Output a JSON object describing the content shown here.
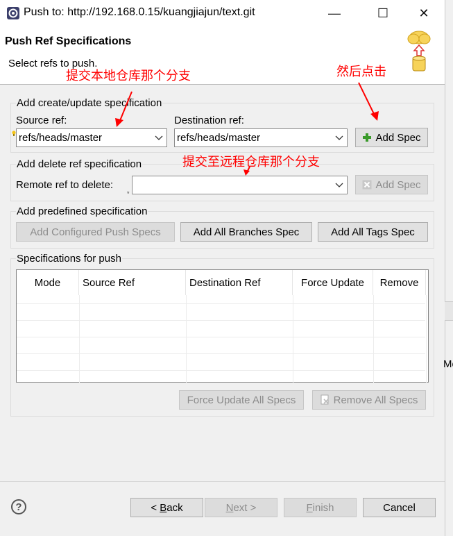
{
  "window": {
    "title": "Push to: http://192.168.0.15/kuangjiajun/text.git",
    "minimize": "—",
    "maximize": "☐",
    "close": "✕"
  },
  "header": {
    "title": "Push Ref Specifications",
    "description": "Select refs to push."
  },
  "create_group": {
    "label": "Add create/update specification",
    "source_label": "Source ref:",
    "source_value": "refs/heads/master",
    "dest_label": "Destination ref:",
    "dest_value": "refs/heads/master",
    "add_spec": "Add Spec"
  },
  "delete_group": {
    "label": "Add delete ref specification",
    "remote_label": "Remote ref to delete:",
    "remote_value": "",
    "add_spec": "Add Spec"
  },
  "predefined_group": {
    "label": "Add predefined specification",
    "configured": "Add Configured Push Specs",
    "all_branches": "Add All Branches Spec",
    "all_tags": "Add All Tags Spec"
  },
  "specs_group": {
    "label": "Specifications for push",
    "columns": [
      "Mode",
      "Source Ref",
      "Destination Ref",
      "Force Update",
      "Remove"
    ],
    "force_all": "Force Update All Specs",
    "remove_all": "Remove All Specs"
  },
  "footer": {
    "help": "?",
    "back_prefix": "< ",
    "back_mn": "B",
    "back_rest": "ack",
    "next_mn": "N",
    "next_rest": "ext >",
    "finish_mn": "F",
    "finish_rest": "inish",
    "cancel": "Cancel"
  },
  "annotations": {
    "local_branch": "提交本地仓库那个分支",
    "then_click": "然后点击",
    "remote_branch": "提交至远程仓库那个分支"
  },
  "edge_fragment": "Me",
  "colors": {
    "annotation": "#ff0000",
    "dialog_bg": "#f0f0f0",
    "plus_green": "#3a9a2a"
  }
}
